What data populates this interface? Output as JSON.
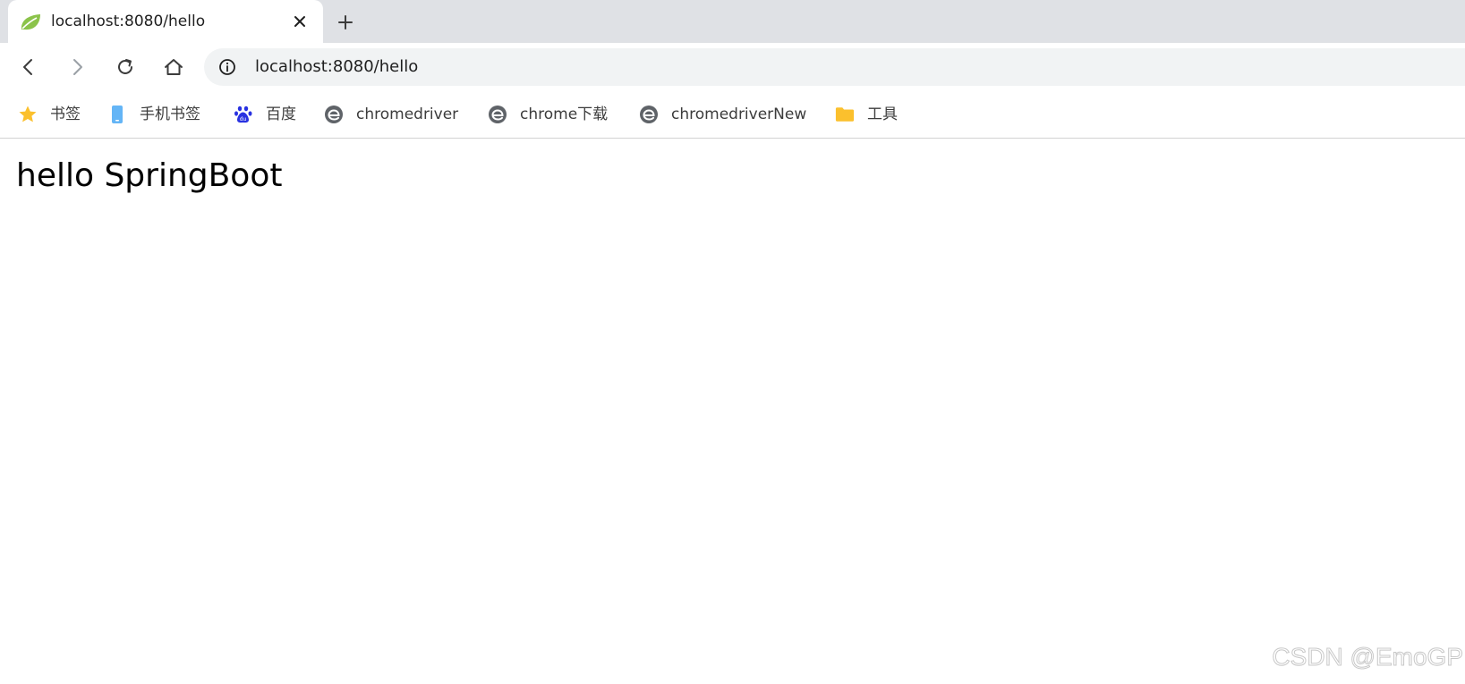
{
  "tab": {
    "title": "localhost:8080/hello",
    "favicon": "spring-leaf-icon"
  },
  "toolbar": {
    "url": "localhost:8080/hello",
    "icons": [
      "back-icon",
      "forward-icon",
      "reload-icon",
      "home-icon",
      "info-icon"
    ]
  },
  "bookmarks": {
    "items": [
      {
        "label": "书签",
        "icon": "star-icon"
      },
      {
        "label": "手机书签",
        "icon": "mobile-icon"
      },
      {
        "label": "百度",
        "icon": "baidu-paw-icon"
      },
      {
        "label": "chromedriver",
        "icon": "e-logo-icon"
      },
      {
        "label": "chrome下载",
        "icon": "e-logo-icon"
      },
      {
        "label": "chromedriverNew",
        "icon": "e-logo-icon"
      },
      {
        "label": "工具",
        "icon": "folder-icon"
      }
    ]
  },
  "page": {
    "heading": "hello SpringBoot"
  },
  "watermark": {
    "text": "CSDN @EmoGP"
  },
  "colors": {
    "tabstrip_bg": "#dfe1e5",
    "omnibox_bg": "#f1f3f4",
    "star": "#fbc02d",
    "folder": "#fbc02d",
    "mobile": "#64b5f6",
    "baidu": "#2932e1",
    "e_logo": "#5f6368",
    "spring_leaf": "#8bc34a"
  }
}
